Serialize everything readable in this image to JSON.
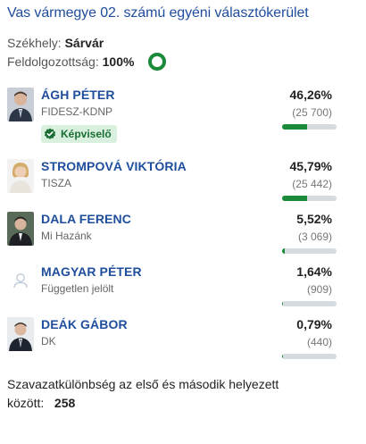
{
  "title": "Vas vármegye 02. számú egyéni választókerület",
  "seat": {
    "label": "Székhely:",
    "value": "Sárvár"
  },
  "processed": {
    "label": "Feldolgozottság:",
    "value": "100%"
  },
  "badge_label": "Képviselő",
  "candidates": [
    {
      "name": "ÁGH PÉTER",
      "party": "FIDESZ-KDNP",
      "percent": "46,26%",
      "votes": "(25 700)",
      "share": 0.4626
    },
    {
      "name": "STROMPOVÁ VIKTÓRIA",
      "party": "TISZA",
      "percent": "45,79%",
      "votes": "(25 442)",
      "share": 0.4579
    },
    {
      "name": "DALA FERENC",
      "party": "Mi Hazánk",
      "percent": "5,52%",
      "votes": "(3 069)",
      "share": 0.0552
    },
    {
      "name": "MAGYAR PÉTER",
      "party": "Független jelölt",
      "percent": "1,64%",
      "votes": "(909)",
      "share": 0.0164
    },
    {
      "name": "DEÁK GÁBOR",
      "party": "DK",
      "percent": "0,79%",
      "votes": "(440)",
      "share": 0.0079
    }
  ],
  "footer": {
    "text_line1": "Szavazatkülönbség az első és második helyezett",
    "text_line2": "között:",
    "difference": "258"
  },
  "colors": {
    "accent": "#1f4e9c",
    "bar": "#1a8a3a",
    "bar_track": "#d6dbe0",
    "badge_bg": "#d9f0df"
  }
}
